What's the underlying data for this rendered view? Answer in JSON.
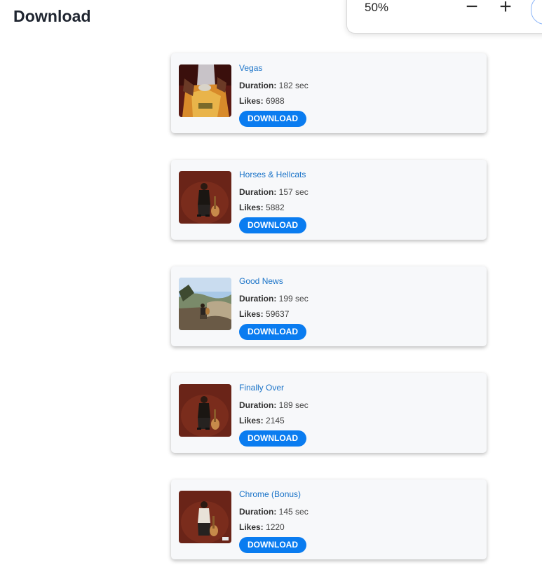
{
  "header": {
    "title": "Download"
  },
  "zoom": {
    "level": "50%",
    "zoom_out_symbol": "−",
    "zoom_in_symbol": "+"
  },
  "labels": {
    "duration": "Duration:",
    "likes": "Likes:",
    "download": "DOWNLOAD"
  },
  "songs": [
    {
      "title": "Vegas",
      "duration": "182 sec",
      "likes": "6988",
      "cover": "vegas-cover"
    },
    {
      "title": "Horses & Hellcats",
      "duration": "157 sec",
      "likes": "5882",
      "cover": "artist-red-cover"
    },
    {
      "title": "Good News",
      "duration": "199 sec",
      "likes": "59637",
      "cover": "outdoor-cover"
    },
    {
      "title": "Finally Over",
      "duration": "189 sec",
      "likes": "2145",
      "cover": "artist-red-cover"
    },
    {
      "title": "Chrome (Bonus)",
      "duration": "145 sec",
      "likes": "1220",
      "cover": "artist-red-cover"
    }
  ],
  "colors": {
    "link": "#1a73c8",
    "button": "#0a7cf0",
    "card_background": "#f7f8fa"
  }
}
